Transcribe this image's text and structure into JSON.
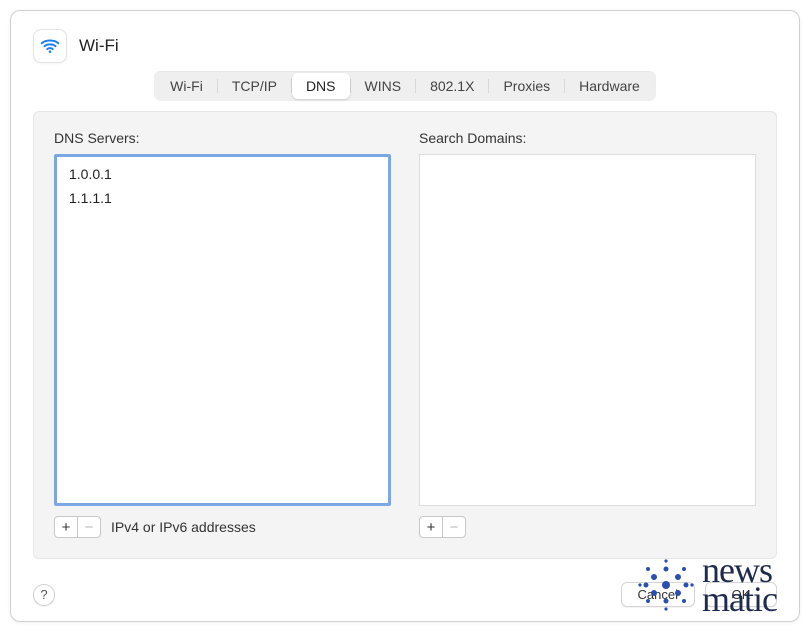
{
  "header": {
    "title": "Wi-Fi",
    "icon": "wifi-icon"
  },
  "tabs": [
    {
      "label": "Wi-Fi",
      "active": false
    },
    {
      "label": "TCP/IP",
      "active": false
    },
    {
      "label": "DNS",
      "active": true
    },
    {
      "label": "WINS",
      "active": false
    },
    {
      "label": "802.1X",
      "active": false
    },
    {
      "label": "Proxies",
      "active": false
    },
    {
      "label": "Hardware",
      "active": false
    }
  ],
  "dns": {
    "label": "DNS Servers:",
    "entries": [
      "1.0.0.1",
      "1.1.1.1"
    ],
    "hint": "IPv4 or IPv6 addresses",
    "add_glyph": "+",
    "remove_glyph": "−"
  },
  "search_domains": {
    "label": "Search Domains:",
    "entries": [],
    "add_glyph": "+",
    "remove_glyph": "−"
  },
  "footer": {
    "help_glyph": "?",
    "cancel_label": "Cancel",
    "ok_label": "OK"
  },
  "watermark": {
    "line1": "news",
    "line2": "matic"
  }
}
